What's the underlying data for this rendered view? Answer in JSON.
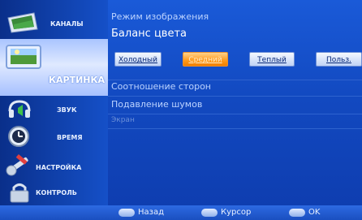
{
  "sidebar": {
    "items": [
      {
        "label": "КАНАЛЫ",
        "icon": "tv-icon"
      },
      {
        "label": "КАРТИНКА",
        "icon": "picture-icon"
      },
      {
        "label": "ЗВУК",
        "icon": "sound-icon"
      },
      {
        "label": "ВРЕМЯ",
        "icon": "clock-icon"
      },
      {
        "label": "НАСТРОЙКА",
        "icon": "wrench-icon"
      },
      {
        "label": "КОНТРОЛЬ",
        "icon": "lock-icon"
      }
    ],
    "active_index": 1
  },
  "panel": {
    "image_mode": "Режим изображения",
    "color_balance": "Баланс цвета",
    "aspect_ratio": "Соотношение сторон",
    "noise_reduction": "Подавление шумов",
    "disabled_item": "Экран",
    "tabs": [
      {
        "label": "Холодный"
      },
      {
        "label": "Средний"
      },
      {
        "label": "Теплый"
      },
      {
        "label": "Польз."
      }
    ],
    "active_tab": 1
  },
  "footer": {
    "back": "Назад",
    "cursor": "Курсор",
    "ok": "OK"
  },
  "colors": {
    "background": "#1249c0",
    "active_tab": "#ff9a1a",
    "active_menu": "#dfe9ff"
  }
}
